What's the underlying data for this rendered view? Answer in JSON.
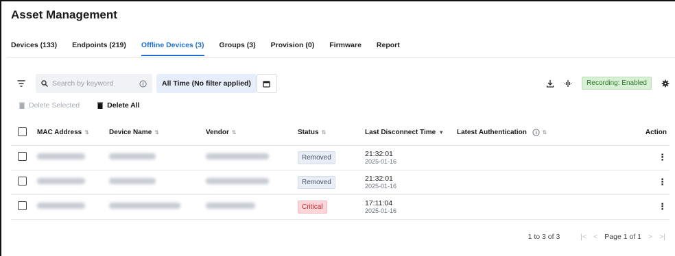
{
  "app": {
    "title": "Asset Management"
  },
  "tabs": [
    {
      "label": "Devices (133)",
      "active": false
    },
    {
      "label": "Endpoints (219)",
      "active": false
    },
    {
      "label": "Offline Devices (3)",
      "active": true
    },
    {
      "label": "Groups (3)",
      "active": false
    },
    {
      "label": "Provision (0)",
      "active": false
    },
    {
      "label": "Firmware",
      "active": false
    },
    {
      "label": "Report",
      "active": false
    }
  ],
  "toolbar": {
    "search_placeholder": "Search by keyword",
    "time_filter": "All Time (No filter applied)",
    "recording_label": "Recording: Enabled",
    "delete_selected": "Delete Selected",
    "delete_all": "Delete All"
  },
  "table": {
    "headers": {
      "mac": "MAC Address",
      "device": "Device Name",
      "vendor": "Vendor",
      "status": "Status",
      "last_disconnect": "Last Disconnect Time",
      "latest_auth": "Latest Authentication",
      "action": "Action"
    },
    "rows": [
      {
        "status": "Removed",
        "time": "21:32:01",
        "date": "2025-01-16"
      },
      {
        "status": "Removed",
        "time": "21:32:01",
        "date": "2025-01-16"
      },
      {
        "status": "Critical",
        "time": "17:11:04",
        "date": "2025-01-16"
      }
    ]
  },
  "pager": {
    "range": "1 to 3 of 3",
    "page": "Page 1 of 1"
  },
  "colors": {
    "accent": "#1f6fd1",
    "removed_bg": "#e9edf5",
    "removed_fg": "#4a5568",
    "critical_bg": "#fbd5d7",
    "critical_fg": "#c0262d",
    "recording_bg": "#d7efd4"
  }
}
